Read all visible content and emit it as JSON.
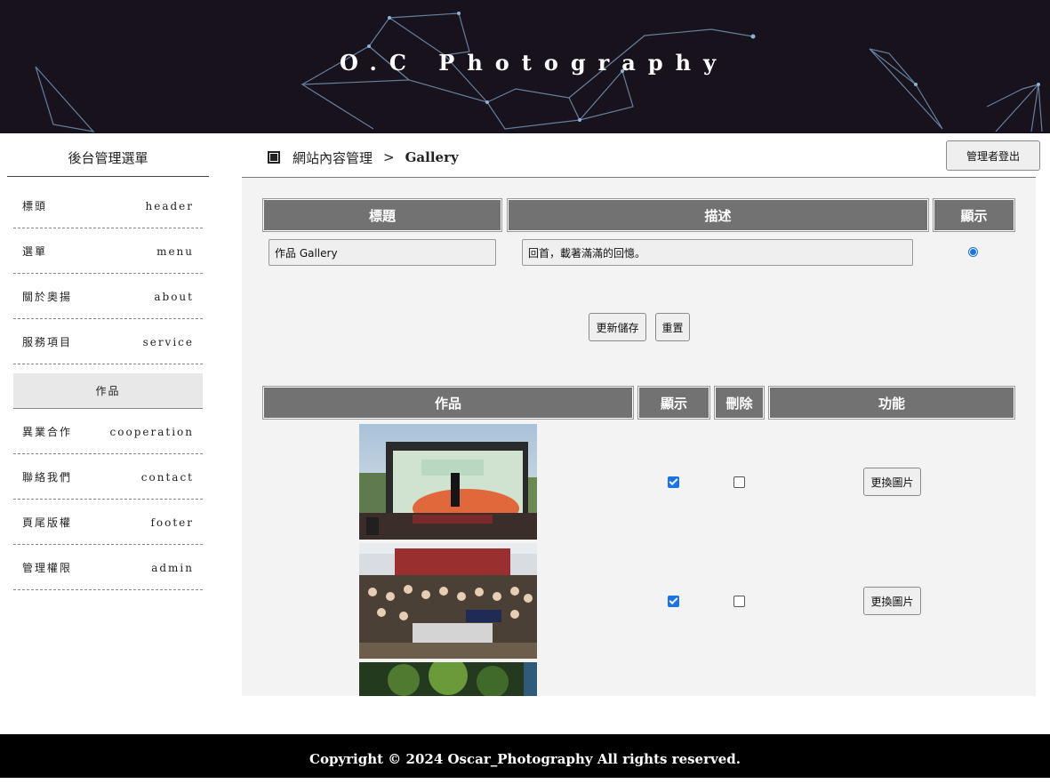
{
  "header": {
    "site_title": "O.C Photography"
  },
  "sidebar": {
    "title": "後台管理選單",
    "items": [
      {
        "zh": "標頭",
        "en": "header"
      },
      {
        "zh": "選單",
        "en": "menu"
      },
      {
        "zh": "關於奧揚",
        "en": "about"
      },
      {
        "zh": "服務項目",
        "en": "service"
      },
      {
        "zh": "作品",
        "en": "",
        "active": true
      },
      {
        "zh": "異業合作",
        "en": "cooperation"
      },
      {
        "zh": "聯絡我們",
        "en": "contact"
      },
      {
        "zh": "頁尾版權",
        "en": "footer"
      },
      {
        "zh": "管理權限",
        "en": "admin"
      }
    ]
  },
  "breadcrumb": {
    "section": "網站內容管理",
    "separator": ">",
    "current": "Gallery"
  },
  "logout_label": "管理者登出",
  "title_table": {
    "headers": [
      "標題",
      "描述",
      "顯示"
    ],
    "row": {
      "title_value": "作品 Gallery",
      "desc_value": "回首，載著滿滿的回憶。",
      "shown": true
    }
  },
  "actions": {
    "save_label": "更新儲存",
    "reset_label": "重置"
  },
  "gallery_table": {
    "headers": [
      "作品",
      "顯示",
      "刪除",
      "功能"
    ],
    "rows": [
      {
        "show": true,
        "delete": false,
        "action_label": "更換圖片"
      },
      {
        "show": true,
        "delete": false,
        "action_label": "更換圖片"
      },
      {
        "show": null,
        "delete": null,
        "action_label": ""
      }
    ]
  },
  "footer": {
    "copyright": "Copyright © 2024 Oscar_Photography All rights reserved."
  },
  "colors": {
    "banner_bg": "#17121b",
    "header_cell": "#727272",
    "panel_bg": "#f3f3f3",
    "accent": "#1a73e8"
  }
}
